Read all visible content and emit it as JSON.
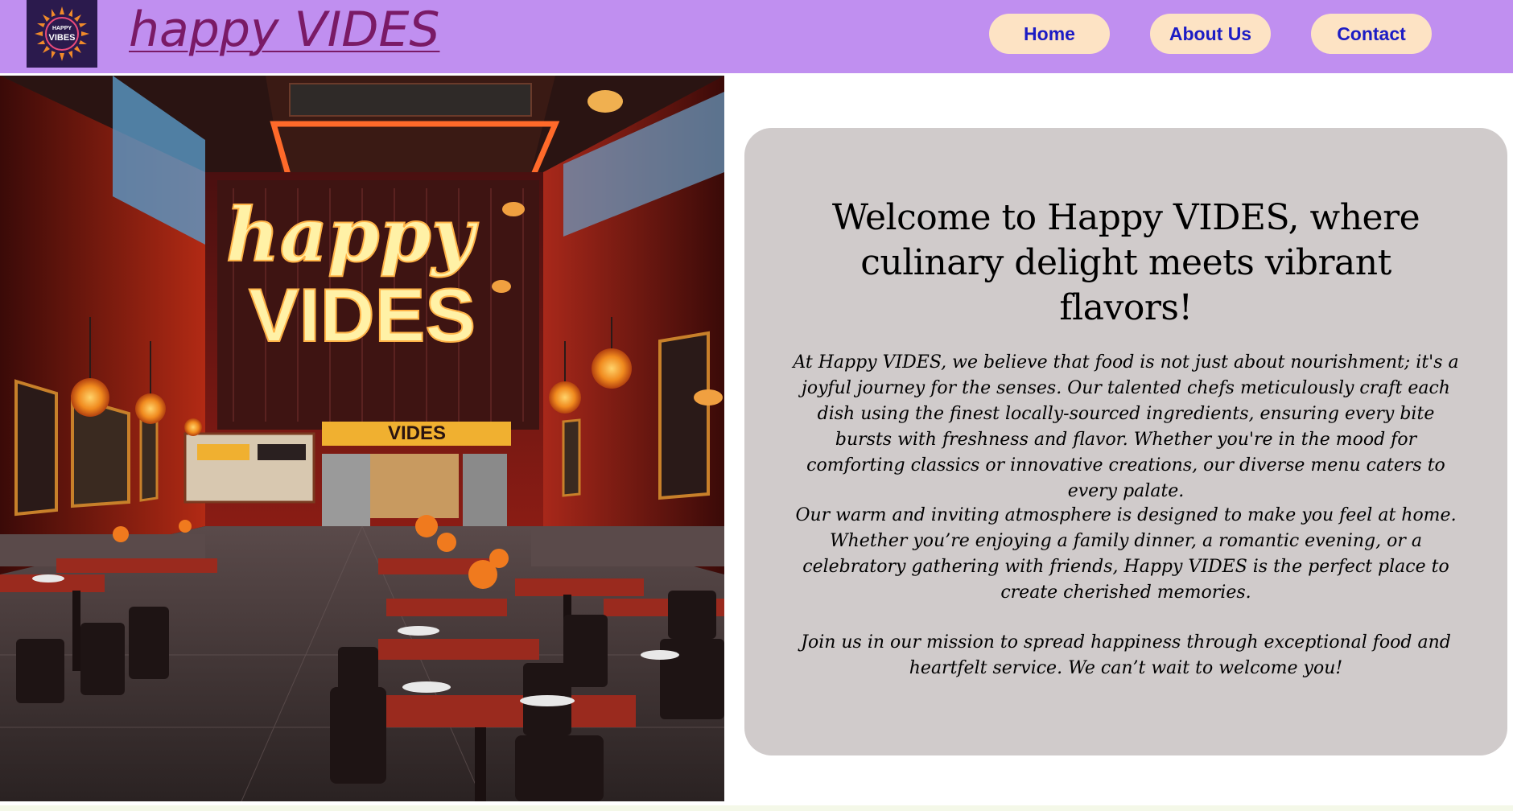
{
  "header": {
    "logo_text_top": "HAPPY",
    "logo_text_bottom": "VIBES",
    "site_title": "happy VIDES",
    "nav": [
      {
        "label": "Home"
      },
      {
        "label": "About Us"
      },
      {
        "label": "Contact"
      }
    ]
  },
  "hero": {
    "sign_line1": "happy",
    "sign_line2": "VIDES",
    "counter_sign": "VIDES"
  },
  "welcome": {
    "heading": "Welcome to Happy VIDES, where culinary delight meets vibrant flavors!",
    "paragraph1": "At Happy VIDES, we believe that food is not just about nourishment; it's a joyful journey for the senses. Our talented chefs meticulously craft each dish using the finest locally-sourced ingredients, ensuring every bite bursts with freshness and flavor. Whether you're in the mood for comforting classics or innovative creations, our diverse menu caters to every palate.",
    "paragraph2": "Our warm and inviting atmosphere is designed to make you feel at home. Whether you’re enjoying a family dinner, a romantic evening, or a celebratory gathering with friends, Happy VIDES is the perfect place to create cherished memories.",
    "paragraph3": "Join us in our mission to spread happiness through exceptional food and heartfelt service. We can’t wait to welcome you!"
  },
  "colors": {
    "header_bg": "#c08ff0",
    "nav_bg": "#fde3c4",
    "nav_text": "#1c1cc4",
    "title_color": "#7a1a66",
    "card_bg": "#d0cbcb"
  }
}
